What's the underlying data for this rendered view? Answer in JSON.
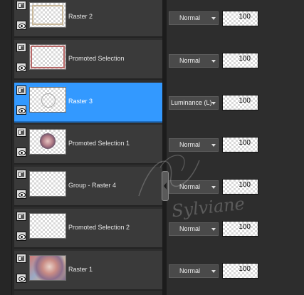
{
  "layers": [
    {
      "name": "Raster 2",
      "blend": "Normal",
      "opacity": "100",
      "thumb": "frame-beige",
      "selected": false
    },
    {
      "name": "Promoted Selection",
      "blend": "Normal",
      "opacity": "100",
      "thumb": "frame-red",
      "selected": false
    },
    {
      "name": "Raster 3",
      "blend": "Luminance (L)",
      "opacity": "100",
      "thumb": "circle",
      "selected": true
    },
    {
      "name": "Promoted Selection 1",
      "blend": "Normal",
      "opacity": "100",
      "thumb": "ball",
      "selected": false
    },
    {
      "name": "Group - Raster 4",
      "blend": "Normal",
      "opacity": "100",
      "thumb": "empty",
      "selected": false
    },
    {
      "name": "Promoted Selection 2",
      "blend": "Normal",
      "opacity": "100",
      "thumb": "empty",
      "selected": false
    },
    {
      "name": "Raster 1",
      "blend": "Normal",
      "opacity": "100",
      "thumb": "swirl",
      "selected": false
    }
  ],
  "watermark": {
    "text": "Sylviane"
  },
  "colors": {
    "selected": "#3399ff",
    "row": "#3a3a3a",
    "background": "#2d2d2d"
  }
}
